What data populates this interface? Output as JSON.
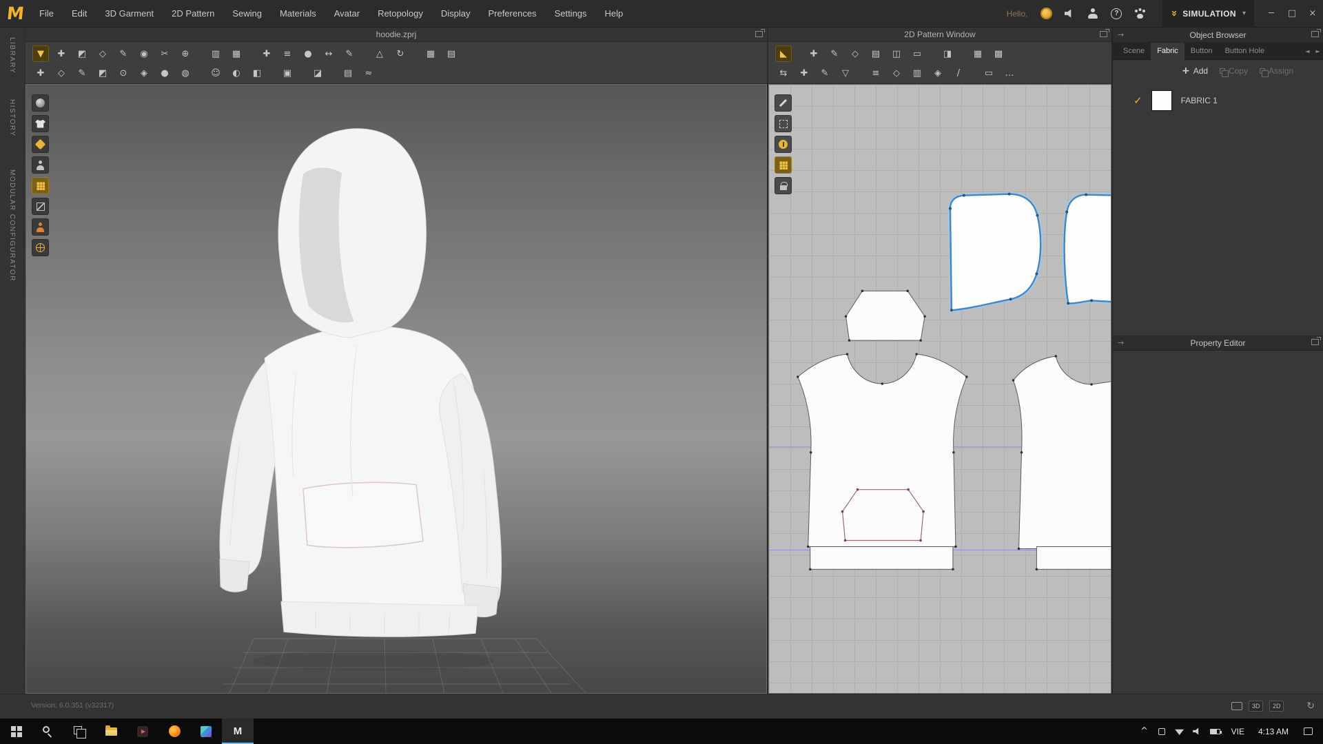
{
  "colors": {
    "accent": "#e8b33d",
    "selection": "#3f87c8",
    "pattern_bg": "#bdbdbd",
    "taskbar_bg": "#0b0b0b"
  },
  "menubar": {
    "logo_text": "M",
    "items": [
      "File",
      "Edit",
      "3D Garment",
      "2D Pattern",
      "Sewing",
      "Materials",
      "Avatar",
      "Retopology",
      "Display",
      "Preferences",
      "Settings",
      "Help"
    ],
    "greeting": "Hello,",
    "icons": [
      {
        "name": "connect-coin-icon",
        "glyph": ""
      },
      {
        "name": "volume-icon",
        "glyph": ""
      },
      {
        "name": "account-icon",
        "glyph": ""
      },
      {
        "name": "help-icon",
        "glyph": "?"
      },
      {
        "name": "paw-icon",
        "glyph": ""
      }
    ],
    "simulation": {
      "chevrons": "»",
      "label": "SIMULATION",
      "caret": "▾"
    },
    "window_controls": {
      "minimize": "─",
      "maximize": "□",
      "close": "×"
    }
  },
  "side_tabs": [
    {
      "label": "LIBRARY",
      "dn": "tab-library",
      "cls": "vt1"
    },
    {
      "label": "HISTORY",
      "dn": "tab-history",
      "cls": "vt2"
    },
    {
      "label": "MODULAR CONFIGURATOR",
      "dn": "tab-modular-configurator",
      "cls": "vt3"
    }
  ],
  "panels": {
    "viewport3d_title": "hoodie.zprj",
    "pattern2d_title": "2D Pattern Window"
  },
  "toolbars": {
    "t3d_row1": [
      {
        "name": "simulate-icon",
        "glyph": "▼",
        "cls": "accent"
      },
      {
        "name": "select-move-icon",
        "glyph": "✚"
      },
      {
        "name": "select-mesh-icon",
        "glyph": "◩"
      },
      {
        "name": "transform-pattern-icon",
        "glyph": "◇"
      },
      {
        "name": "edit-sculpt-icon",
        "glyph": "✎"
      },
      {
        "name": "pin-icon",
        "glyph": "◉"
      },
      {
        "name": "sewing-3d-icon",
        "glyph": "✂"
      },
      {
        "name": "tack-on-avatar-icon",
        "glyph": "⊕"
      },
      {
        "name": "fold-arrangement-icon",
        "glyph": "▥",
        "cls": "grp"
      },
      {
        "name": "flatten-icon",
        "glyph": "▦"
      },
      {
        "name": "safety-pin-icon",
        "glyph": "✚",
        "cls": "grp"
      },
      {
        "name": "seam-taping-icon",
        "glyph": "≡"
      },
      {
        "name": "steam-brush-icon",
        "glyph": "●"
      },
      {
        "name": "measure-tape-icon",
        "glyph": "↔"
      },
      {
        "name": "stylus-pen-icon",
        "glyph": "✎"
      },
      {
        "name": "grainline-icon",
        "glyph": "△",
        "cls": "grp"
      },
      {
        "name": "reset-arrangement-icon",
        "glyph": "↻"
      },
      {
        "name": "grid-3d-icon",
        "glyph": "▦",
        "cls": "grp"
      },
      {
        "name": "snap-3d-icon",
        "glyph": "▤"
      }
    ],
    "t3d_row2": [
      {
        "name": "select-avatar-icon",
        "glyph": "✚"
      },
      {
        "name": "avatar-tape-icon",
        "glyph": "◇"
      },
      {
        "name": "avatar-measure-icon",
        "glyph": "✎"
      },
      {
        "name": "avatar-circumference-icon",
        "glyph": "◩"
      },
      {
        "name": "arrangement-point-icon",
        "glyph": "⊙"
      },
      {
        "name": "bounding-volume-icon",
        "glyph": "◈"
      },
      {
        "name": "avatar-pose-icon",
        "glyph": "●"
      },
      {
        "name": "avatar-joint-icon",
        "glyph": "◍"
      },
      {
        "name": "avatar-face-icon",
        "glyph": "☺",
        "cls": "grp"
      },
      {
        "name": "avatar-hair-icon",
        "glyph": "◐"
      },
      {
        "name": "avatar-shoe-icon",
        "glyph": "◧"
      },
      {
        "name": "render-icon",
        "glyph": "▣",
        "cls": "grp"
      },
      {
        "name": "flatten-mesh-icon",
        "glyph": "◪",
        "cls": "grp"
      },
      {
        "name": "uv-editor-icon",
        "glyph": "▤",
        "cls": "grp"
      },
      {
        "name": "wind-controller-icon",
        "glyph": "≈"
      }
    ],
    "t2d_row1": [
      {
        "name": "show-pattern-icon",
        "glyph": "◣",
        "cls": "accent"
      },
      {
        "name": "select-2d-icon",
        "glyph": "✚",
        "cls": "grp"
      },
      {
        "name": "edit-pattern-icon",
        "glyph": "✎"
      },
      {
        "name": "add-point-icon",
        "glyph": "◇"
      },
      {
        "name": "folder-2d-icon",
        "glyph": "▤"
      },
      {
        "name": "trace-icon",
        "glyph": "◫"
      },
      {
        "name": "seam-allowance-icon",
        "glyph": "▭"
      },
      {
        "name": "texture-editor-icon",
        "glyph": "◨",
        "cls": "grp"
      },
      {
        "name": "grid-2d-icon",
        "glyph": "▦",
        "cls": "grp"
      },
      {
        "name": "snap-2d-icon",
        "glyph": "▩"
      }
    ],
    "t2d_row2": [
      {
        "name": "segment-sewing-icon",
        "glyph": "⇆"
      },
      {
        "name": "free-sewing-icon",
        "glyph": "✚"
      },
      {
        "name": "edit-sewing-icon",
        "glyph": "✎"
      },
      {
        "name": "detach-sewing-icon",
        "glyph": "▽"
      },
      {
        "name": "internal-line-icon",
        "glyph": "≡",
        "cls": "grp"
      },
      {
        "name": "dart-icon",
        "glyph": "◇"
      },
      {
        "name": "notch-icon",
        "glyph": "▥"
      },
      {
        "name": "buttonhole-2d-icon",
        "glyph": "◈"
      },
      {
        "name": "zipper-icon",
        "glyph": "/"
      },
      {
        "name": "piping-icon",
        "glyph": "▭",
        "cls": "grp"
      },
      {
        "name": "more-tools-icon",
        "glyph": "…"
      }
    ]
  },
  "viewport3d_icons": [
    {
      "name": "show-gizmo-icon",
      "cls": ""
    },
    {
      "name": "show-garment-icon",
      "cls": ""
    },
    {
      "name": "show-internal-lines-icon",
      "cls": ""
    },
    {
      "name": "show-avatar-icon",
      "cls": ""
    },
    {
      "name": "show-fabric-texture-icon",
      "cls": "active"
    },
    {
      "name": "show-seamline-icon",
      "cls": ""
    },
    {
      "name": "show-avatar-skin-icon",
      "cls": ""
    },
    {
      "name": "show-avatar-mesh-icon",
      "cls": ""
    }
  ],
  "viewport2d_icons": [
    {
      "name": "edit-texture-2d-icon",
      "cls": ""
    },
    {
      "name": "show-seam-2d-icon",
      "cls": ""
    },
    {
      "name": "show-info-2d-icon",
      "cls": ""
    },
    {
      "name": "show-fabric-2d-icon",
      "cls": "active"
    },
    {
      "name": "show-lock-2d-icon",
      "cls": ""
    }
  ],
  "object_browser": {
    "title": "Object Browser",
    "expand_glyph": "→",
    "tabs": [
      {
        "label": "Scene",
        "dn": "tab-scene",
        "cls": ""
      },
      {
        "label": "Fabric",
        "dn": "tab-fabric",
        "cls": "active"
      },
      {
        "label": "Button",
        "dn": "tab-button",
        "cls": ""
      },
      {
        "label": "Button Hole",
        "dn": "tab-button-hole",
        "cls": ""
      }
    ],
    "tab_left": "◄",
    "tab_right": "►",
    "add_plus": "+",
    "add_label": "Add",
    "copy_label": "Copy",
    "assign_label": "Assign",
    "check_glyph": "✓",
    "fabrics": [
      {
        "name": "FABRIC 1"
      }
    ]
  },
  "property_editor": {
    "title": "Property Editor",
    "expand_glyph": "→"
  },
  "statusbar": {
    "version": "Version: 6.0.351 (v32317)",
    "badge_3d": "3D",
    "badge_2d": "2D",
    "sync_glyph": "↻"
  },
  "taskbar": {
    "apps": [
      {
        "name": "start-button",
        "cls": "tk-start"
      },
      {
        "name": "search-button",
        "cls": "tk-search"
      },
      {
        "name": "task-view-button",
        "cls": "tk-taskview"
      },
      {
        "name": "file-explorer-button",
        "cls": "tk-folder"
      },
      {
        "name": "media-app-button",
        "cls": "tk-media"
      },
      {
        "name": "browser-button",
        "cls": "tk-firefox"
      },
      {
        "name": "photos-app-button",
        "cls": "tk-photos"
      },
      {
        "name": "marvelous-designer-button",
        "cls": "tk-md active",
        "label": "M"
      }
    ],
    "tray_chevron": "^",
    "tray_icons": [
      {
        "name": "tray-app-icon",
        "cls": "tk-trayapp"
      },
      {
        "name": "wifi-icon",
        "cls": "tk-wifi"
      },
      {
        "name": "volume-tray-icon",
        "cls": "tk-vol"
      },
      {
        "name": "battery-icon",
        "cls": "tk-batt"
      }
    ],
    "language": "VIE",
    "time": "4:13 AM"
  }
}
